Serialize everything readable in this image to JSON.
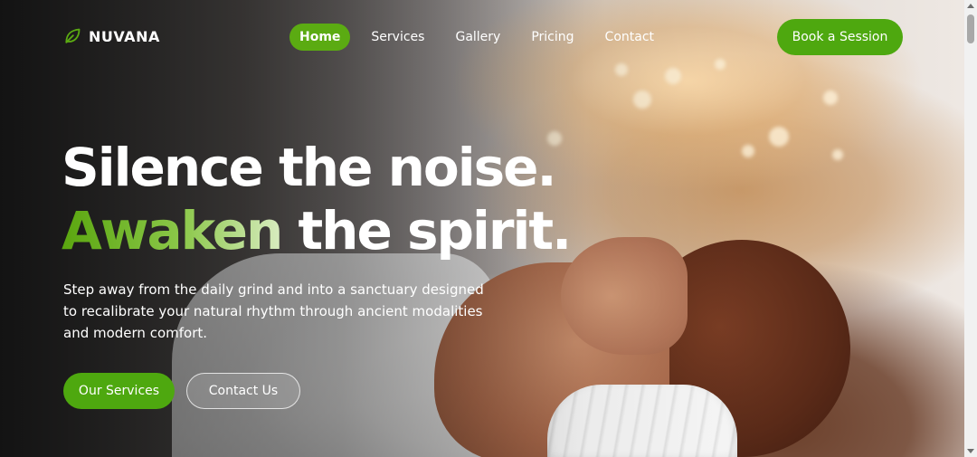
{
  "brand": {
    "name": "NUVANA",
    "icon": "leaf-icon",
    "accent_color": "#4ea80f"
  },
  "nav": {
    "links": [
      {
        "label": "Home",
        "active": true
      },
      {
        "label": "Services",
        "active": false
      },
      {
        "label": "Gallery",
        "active": false
      },
      {
        "label": "Pricing",
        "active": false
      },
      {
        "label": "Contact",
        "active": false
      }
    ],
    "cta_label": "Book a Session"
  },
  "hero": {
    "headline_line1": "Silence the noise.",
    "headline_accent": "Awaken",
    "headline_line2_rest": " the spirit.",
    "subtext": "Step away from the daily grind and into a sanctuary designed to recalibrate your natural rhythm through ancient modalities and modern comfort.",
    "primary_cta": "Our Services",
    "secondary_cta": "Contact Us",
    "background_image": "woman-relaxing-spa-photo"
  }
}
